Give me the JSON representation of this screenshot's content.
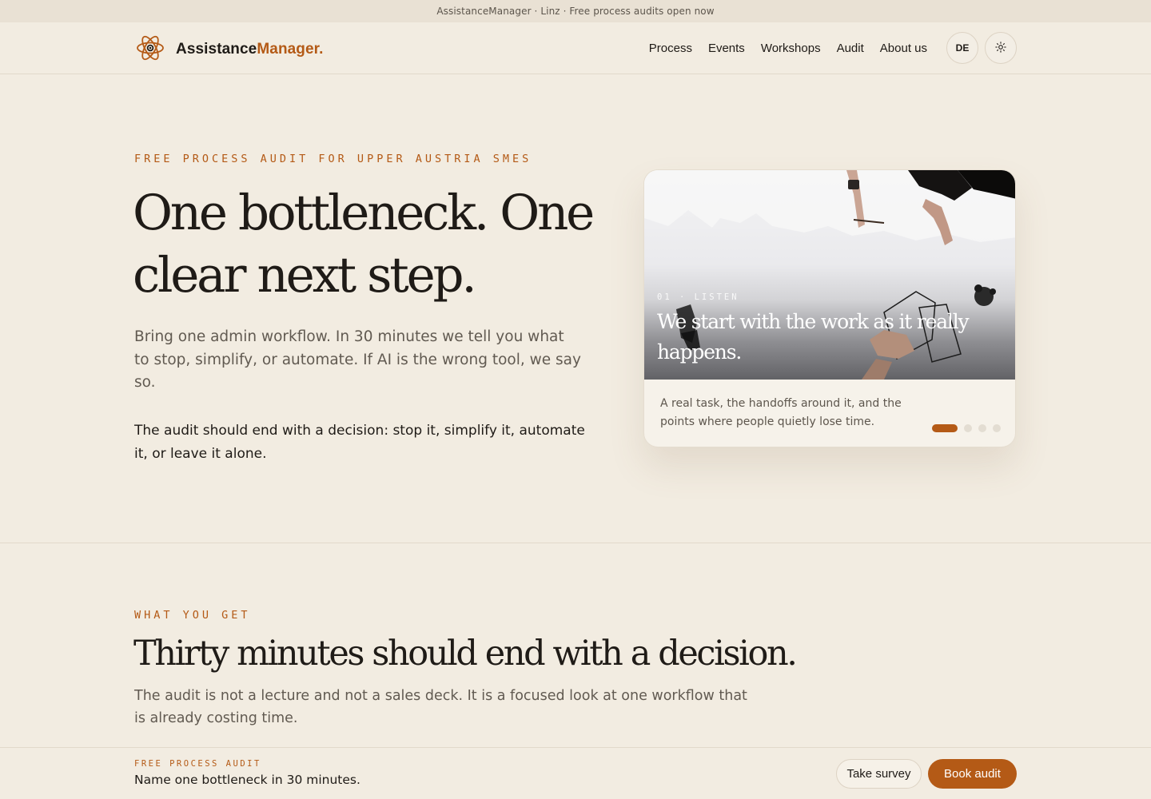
{
  "announcement": "AssistanceManager · Linz · Free process audits open now",
  "brand": {
    "name_part1": "Assistance",
    "name_part2": "Manager.",
    "logo_icon": "atom-icon"
  },
  "nav": {
    "items": [
      {
        "label": "Process"
      },
      {
        "label": "Events"
      },
      {
        "label": "Workshops"
      },
      {
        "label": "Audit"
      },
      {
        "label": "About us"
      }
    ],
    "lang_toggle": "DE",
    "theme_toggle_icon": "sun-icon"
  },
  "hero": {
    "eyebrow": "FREE PROCESS AUDIT FOR UPPER AUSTRIA SMES",
    "title": "One bottleneck. One clear next step.",
    "lead": "Bring one admin workflow. In 30 minutes we tell you what to stop, simplify, or automate. If AI is the wrong tool, we say so.",
    "note": "The audit should end with a decision: stop it, simplify it, automate it, or leave it alone."
  },
  "carousel": {
    "step": "01 · LISTEN",
    "heading": "We start with the work as it really happens.",
    "text": "A real task, the handoffs around it, and the points where people quietly lose time.",
    "slides_total": 4,
    "active_index": 0
  },
  "what_you_get": {
    "eyebrow": "WHAT YOU GET",
    "title": "Thirty minutes should end with a decision.",
    "lead": "The audit is not a lecture and not a sales deck. It is a focused look at one workflow that is already costing time."
  },
  "sticky_bar": {
    "eyebrow": "FREE PROCESS AUDIT",
    "text": "Name one bottleneck in 30 minutes.",
    "survey_label": "Take survey",
    "book_label": "Book audit"
  },
  "colors": {
    "accent": "#b45a16",
    "background": "#f2ece1",
    "text": "#1f1b17"
  }
}
